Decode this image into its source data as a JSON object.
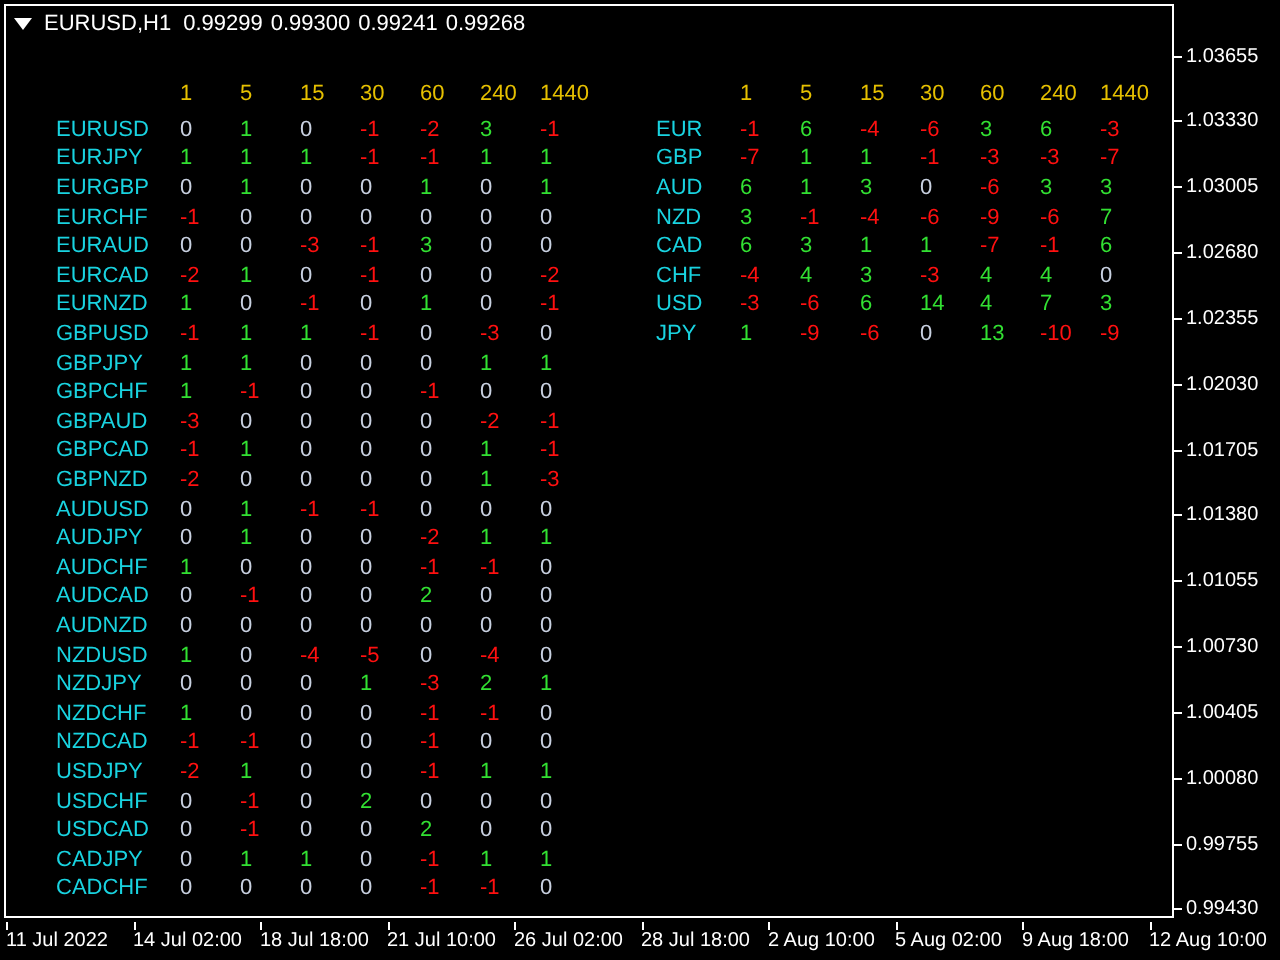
{
  "chart_header": {
    "symbol": "EURUSD,H1",
    "prices": [
      "0.99299",
      "0.99300",
      "0.99241",
      "0.99268"
    ]
  },
  "pair_table": {
    "columns": [
      "1",
      "5",
      "15",
      "30",
      "60",
      "240",
      "1440"
    ],
    "rows": [
      {
        "symbol": "EURUSD",
        "cells": [
          {
            "text": "0",
            "color": "#c8d0e0"
          },
          {
            "text": "1",
            "color": "#32e032"
          },
          {
            "text": "0",
            "color": "#c8d0e0"
          },
          {
            "text": "-1",
            "color": "#ff1010"
          },
          {
            "text": "-2",
            "color": "#ff1010"
          },
          {
            "text": "3",
            "color": "#32e032"
          },
          {
            "text": "-1",
            "color": "#ff1010"
          }
        ]
      },
      {
        "symbol": "EURJPY",
        "cells": [
          {
            "text": "1",
            "color": "#32e032"
          },
          {
            "text": "1",
            "color": "#32e032"
          },
          {
            "text": "1",
            "color": "#32e032"
          },
          {
            "text": "-1",
            "color": "#ff1010"
          },
          {
            "text": "-1",
            "color": "#ff1010"
          },
          {
            "text": "1",
            "color": "#32e032"
          },
          {
            "text": "1",
            "color": "#32e032"
          }
        ]
      },
      {
        "symbol": "EURGBP",
        "cells": [
          {
            "text": "0",
            "color": "#c8d0e0"
          },
          {
            "text": "1",
            "color": "#32e032"
          },
          {
            "text": "0",
            "color": "#c8d0e0"
          },
          {
            "text": "0",
            "color": "#c8d0e0"
          },
          {
            "text": "1",
            "color": "#32e032"
          },
          {
            "text": "0",
            "color": "#c8d0e0"
          },
          {
            "text": "1",
            "color": "#32e032"
          }
        ]
      },
      {
        "symbol": "EURCHF",
        "cells": [
          {
            "text": "-1",
            "color": "#ff1010"
          },
          {
            "text": "0",
            "color": "#c8d0e0"
          },
          {
            "text": "0",
            "color": "#c8d0e0"
          },
          {
            "text": "0",
            "color": "#c8d0e0"
          },
          {
            "text": "0",
            "color": "#c8d0e0"
          },
          {
            "text": "0",
            "color": "#c8d0e0"
          },
          {
            "text": "0",
            "color": "#c8d0e0"
          }
        ]
      },
      {
        "symbol": "EURAUD",
        "cells": [
          {
            "text": "0",
            "color": "#c8d0e0"
          },
          {
            "text": "0",
            "color": "#c8d0e0"
          },
          {
            "text": "-3",
            "color": "#ff1010"
          },
          {
            "text": "-1",
            "color": "#ff1010"
          },
          {
            "text": "3",
            "color": "#32e032"
          },
          {
            "text": "0",
            "color": "#c8d0e0"
          },
          {
            "text": "0",
            "color": "#c8d0e0"
          }
        ]
      },
      {
        "symbol": "EURCAD",
        "cells": [
          {
            "text": "-2",
            "color": "#ff1010"
          },
          {
            "text": "1",
            "color": "#32e032"
          },
          {
            "text": "0",
            "color": "#c8d0e0"
          },
          {
            "text": "-1",
            "color": "#ff1010"
          },
          {
            "text": "0",
            "color": "#c8d0e0"
          },
          {
            "text": "0",
            "color": "#c8d0e0"
          },
          {
            "text": "-2",
            "color": "#ff1010"
          }
        ]
      },
      {
        "symbol": "EURNZD",
        "cells": [
          {
            "text": "1",
            "color": "#32e032"
          },
          {
            "text": "0",
            "color": "#c8d0e0"
          },
          {
            "text": "-1",
            "color": "#ff1010"
          },
          {
            "text": "0",
            "color": "#c8d0e0"
          },
          {
            "text": "1",
            "color": "#32e032"
          },
          {
            "text": "0",
            "color": "#c8d0e0"
          },
          {
            "text": "-1",
            "color": "#ff1010"
          }
        ]
      },
      {
        "symbol": "GBPUSD",
        "cells": [
          {
            "text": "-1",
            "color": "#ff1010"
          },
          {
            "text": "1",
            "color": "#32e032"
          },
          {
            "text": "1",
            "color": "#32e032"
          },
          {
            "text": "-1",
            "color": "#ff1010"
          },
          {
            "text": "0",
            "color": "#c8d0e0"
          },
          {
            "text": "-3",
            "color": "#ff1010"
          },
          {
            "text": "0",
            "color": "#c8d0e0"
          }
        ]
      },
      {
        "symbol": "GBPJPY",
        "cells": [
          {
            "text": "1",
            "color": "#32e032"
          },
          {
            "text": "1",
            "color": "#32e032"
          },
          {
            "text": "0",
            "color": "#c8d0e0"
          },
          {
            "text": "0",
            "color": "#c8d0e0"
          },
          {
            "text": "0",
            "color": "#c8d0e0"
          },
          {
            "text": "1",
            "color": "#32e032"
          },
          {
            "text": "1",
            "color": "#32e032"
          }
        ]
      },
      {
        "symbol": "GBPCHF",
        "cells": [
          {
            "text": "1",
            "color": "#32e032"
          },
          {
            "text": "-1",
            "color": "#ff1010"
          },
          {
            "text": "0",
            "color": "#c8d0e0"
          },
          {
            "text": "0",
            "color": "#c8d0e0"
          },
          {
            "text": "-1",
            "color": "#ff1010"
          },
          {
            "text": "0",
            "color": "#c8d0e0"
          },
          {
            "text": "0",
            "color": "#c8d0e0"
          }
        ]
      },
      {
        "symbol": "GBPAUD",
        "cells": [
          {
            "text": "-3",
            "color": "#ff1010"
          },
          {
            "text": "0",
            "color": "#c8d0e0"
          },
          {
            "text": "0",
            "color": "#c8d0e0"
          },
          {
            "text": "0",
            "color": "#c8d0e0"
          },
          {
            "text": "0",
            "color": "#c8d0e0"
          },
          {
            "text": "-2",
            "color": "#ff1010"
          },
          {
            "text": "-1",
            "color": "#ff1010"
          }
        ]
      },
      {
        "symbol": "GBPCAD",
        "cells": [
          {
            "text": "-1",
            "color": "#ff1010"
          },
          {
            "text": "1",
            "color": "#32e032"
          },
          {
            "text": "0",
            "color": "#c8d0e0"
          },
          {
            "text": "0",
            "color": "#c8d0e0"
          },
          {
            "text": "0",
            "color": "#c8d0e0"
          },
          {
            "text": "1",
            "color": "#32e032"
          },
          {
            "text": "-1",
            "color": "#ff1010"
          }
        ]
      },
      {
        "symbol": "GBPNZD",
        "cells": [
          {
            "text": "-2",
            "color": "#ff1010"
          },
          {
            "text": "0",
            "color": "#c8d0e0"
          },
          {
            "text": "0",
            "color": "#c8d0e0"
          },
          {
            "text": "0",
            "color": "#c8d0e0"
          },
          {
            "text": "0",
            "color": "#c8d0e0"
          },
          {
            "text": "1",
            "color": "#32e032"
          },
          {
            "text": "-3",
            "color": "#ff1010"
          }
        ]
      },
      {
        "symbol": "AUDUSD",
        "cells": [
          {
            "text": "0",
            "color": "#c8d0e0"
          },
          {
            "text": "1",
            "color": "#32e032"
          },
          {
            "text": "-1",
            "color": "#ff1010"
          },
          {
            "text": "-1",
            "color": "#ff1010"
          },
          {
            "text": "0",
            "color": "#c8d0e0"
          },
          {
            "text": "0",
            "color": "#c8d0e0"
          },
          {
            "text": "0",
            "color": "#c8d0e0"
          }
        ]
      },
      {
        "symbol": "AUDJPY",
        "cells": [
          {
            "text": "0",
            "color": "#c8d0e0"
          },
          {
            "text": "1",
            "color": "#32e032"
          },
          {
            "text": "0",
            "color": "#c8d0e0"
          },
          {
            "text": "0",
            "color": "#c8d0e0"
          },
          {
            "text": "-2",
            "color": "#ff1010"
          },
          {
            "text": "1",
            "color": "#32e032"
          },
          {
            "text": "1",
            "color": "#32e032"
          }
        ]
      },
      {
        "symbol": "AUDCHF",
        "cells": [
          {
            "text": "1",
            "color": "#32e032"
          },
          {
            "text": "0",
            "color": "#c8d0e0"
          },
          {
            "text": "0",
            "color": "#c8d0e0"
          },
          {
            "text": "0",
            "color": "#c8d0e0"
          },
          {
            "text": "-1",
            "color": "#ff1010"
          },
          {
            "text": "-1",
            "color": "#ff1010"
          },
          {
            "text": "0",
            "color": "#c8d0e0"
          }
        ]
      },
      {
        "symbol": "AUDCAD",
        "cells": [
          {
            "text": "0",
            "color": "#c8d0e0"
          },
          {
            "text": "-1",
            "color": "#ff1010"
          },
          {
            "text": "0",
            "color": "#c8d0e0"
          },
          {
            "text": "0",
            "color": "#c8d0e0"
          },
          {
            "text": "2",
            "color": "#32e032"
          },
          {
            "text": "0",
            "color": "#c8d0e0"
          },
          {
            "text": "0",
            "color": "#c8d0e0"
          }
        ]
      },
      {
        "symbol": "AUDNZD",
        "cells": [
          {
            "text": "0",
            "color": "#c8d0e0"
          },
          {
            "text": "0",
            "color": "#c8d0e0"
          },
          {
            "text": "0",
            "color": "#c8d0e0"
          },
          {
            "text": "0",
            "color": "#c8d0e0"
          },
          {
            "text": "0",
            "color": "#c8d0e0"
          },
          {
            "text": "0",
            "color": "#c8d0e0"
          },
          {
            "text": "0",
            "color": "#c8d0e0"
          }
        ]
      },
      {
        "symbol": "NZDUSD",
        "cells": [
          {
            "text": "1",
            "color": "#32e032"
          },
          {
            "text": "0",
            "color": "#c8d0e0"
          },
          {
            "text": "-4",
            "color": "#ff1010"
          },
          {
            "text": "-5",
            "color": "#ff1010"
          },
          {
            "text": "0",
            "color": "#c8d0e0"
          },
          {
            "text": "-4",
            "color": "#ff1010"
          },
          {
            "text": "0",
            "color": "#c8d0e0"
          }
        ]
      },
      {
        "symbol": "NZDJPY",
        "cells": [
          {
            "text": "0",
            "color": "#c8d0e0"
          },
          {
            "text": "0",
            "color": "#c8d0e0"
          },
          {
            "text": "0",
            "color": "#c8d0e0"
          },
          {
            "text": "1",
            "color": "#32e032"
          },
          {
            "text": "-3",
            "color": "#ff1010"
          },
          {
            "text": "2",
            "color": "#32e032"
          },
          {
            "text": "1",
            "color": "#32e032"
          }
        ]
      },
      {
        "symbol": "NZDCHF",
        "cells": [
          {
            "text": "1",
            "color": "#32e032"
          },
          {
            "text": "0",
            "color": "#c8d0e0"
          },
          {
            "text": "0",
            "color": "#c8d0e0"
          },
          {
            "text": "0",
            "color": "#c8d0e0"
          },
          {
            "text": "-1",
            "color": "#ff1010"
          },
          {
            "text": "-1",
            "color": "#ff1010"
          },
          {
            "text": "0",
            "color": "#c8d0e0"
          }
        ]
      },
      {
        "symbol": "NZDCAD",
        "cells": [
          {
            "text": "-1",
            "color": "#ff1010"
          },
          {
            "text": "-1",
            "color": "#ff1010"
          },
          {
            "text": "0",
            "color": "#c8d0e0"
          },
          {
            "text": "0",
            "color": "#c8d0e0"
          },
          {
            "text": "-1",
            "color": "#ff1010"
          },
          {
            "text": "0",
            "color": "#c8d0e0"
          },
          {
            "text": "0",
            "color": "#c8d0e0"
          }
        ]
      },
      {
        "symbol": "USDJPY",
        "cells": [
          {
            "text": "-2",
            "color": "#ff1010"
          },
          {
            "text": "1",
            "color": "#32e032"
          },
          {
            "text": "0",
            "color": "#c8d0e0"
          },
          {
            "text": "0",
            "color": "#c8d0e0"
          },
          {
            "text": "-1",
            "color": "#ff1010"
          },
          {
            "text": "1",
            "color": "#32e032"
          },
          {
            "text": "1",
            "color": "#32e032"
          }
        ]
      },
      {
        "symbol": "USDCHF",
        "cells": [
          {
            "text": "0",
            "color": "#c8d0e0"
          },
          {
            "text": "-1",
            "color": "#ff1010"
          },
          {
            "text": "0",
            "color": "#c8d0e0"
          },
          {
            "text": "2",
            "color": "#32e032"
          },
          {
            "text": "0",
            "color": "#c8d0e0"
          },
          {
            "text": "0",
            "color": "#c8d0e0"
          },
          {
            "text": "0",
            "color": "#c8d0e0"
          }
        ]
      },
      {
        "symbol": "USDCAD",
        "cells": [
          {
            "text": "0",
            "color": "#c8d0e0"
          },
          {
            "text": "-1",
            "color": "#ff1010"
          },
          {
            "text": "0",
            "color": "#c8d0e0"
          },
          {
            "text": "0",
            "color": "#c8d0e0"
          },
          {
            "text": "2",
            "color": "#32e032"
          },
          {
            "text": "0",
            "color": "#c8d0e0"
          },
          {
            "text": "0",
            "color": "#c8d0e0"
          }
        ]
      },
      {
        "symbol": "CADJPY",
        "cells": [
          {
            "text": "0",
            "color": "#c8d0e0"
          },
          {
            "text": "1",
            "color": "#32e032"
          },
          {
            "text": "1",
            "color": "#32e032"
          },
          {
            "text": "0",
            "color": "#c8d0e0"
          },
          {
            "text": "-1",
            "color": "#ff1010"
          },
          {
            "text": "1",
            "color": "#32e032"
          },
          {
            "text": "1",
            "color": "#32e032"
          }
        ]
      },
      {
        "symbol": "CADCHF",
        "cells": [
          {
            "text": "0",
            "color": "#c8d0e0"
          },
          {
            "text": "0",
            "color": "#c8d0e0"
          },
          {
            "text": "0",
            "color": "#c8d0e0"
          },
          {
            "text": "0",
            "color": "#c8d0e0"
          },
          {
            "text": "-1",
            "color": "#ff1010"
          },
          {
            "text": "-1",
            "color": "#ff1010"
          },
          {
            "text": "0",
            "color": "#c8d0e0"
          }
        ]
      }
    ]
  },
  "currency_table": {
    "columns": [
      "1",
      "5",
      "15",
      "30",
      "60",
      "240",
      "1440"
    ],
    "rows": [
      {
        "symbol": "EUR",
        "cells": [
          {
            "text": "-1",
            "color": "#ff1010"
          },
          {
            "text": "6",
            "color": "#32e032"
          },
          {
            "text": "-4",
            "color": "#ff1010"
          },
          {
            "text": "-6",
            "color": "#ff1010"
          },
          {
            "text": "3",
            "color": "#32e032"
          },
          {
            "text": "6",
            "color": "#32e032"
          },
          {
            "text": "-3",
            "color": "#ff1010"
          }
        ]
      },
      {
        "symbol": "GBP",
        "cells": [
          {
            "text": "-7",
            "color": "#ff1010"
          },
          {
            "text": "1",
            "color": "#32e032"
          },
          {
            "text": "1",
            "color": "#32e032"
          },
          {
            "text": "-1",
            "color": "#ff1010"
          },
          {
            "text": "-3",
            "color": "#ff1010"
          },
          {
            "text": "-3",
            "color": "#ff1010"
          },
          {
            "text": "-7",
            "color": "#ff1010"
          }
        ]
      },
      {
        "symbol": "AUD",
        "cells": [
          {
            "text": "6",
            "color": "#32e032"
          },
          {
            "text": "1",
            "color": "#32e032"
          },
          {
            "text": "3",
            "color": "#32e032"
          },
          {
            "text": "0",
            "color": "#c8d0e0"
          },
          {
            "text": "-6",
            "color": "#ff1010"
          },
          {
            "text": "3",
            "color": "#32e032"
          },
          {
            "text": "3",
            "color": "#32e032"
          }
        ]
      },
      {
        "symbol": "NZD",
        "cells": [
          {
            "text": "3",
            "color": "#32e032"
          },
          {
            "text": "-1",
            "color": "#ff1010"
          },
          {
            "text": "-4",
            "color": "#ff1010"
          },
          {
            "text": "-6",
            "color": "#ff1010"
          },
          {
            "text": "-9",
            "color": "#ff1010"
          },
          {
            "text": "-6",
            "color": "#ff1010"
          },
          {
            "text": "7",
            "color": "#32e032"
          }
        ]
      },
      {
        "symbol": "CAD",
        "cells": [
          {
            "text": "6",
            "color": "#32e032"
          },
          {
            "text": "3",
            "color": "#32e032"
          },
          {
            "text": "1",
            "color": "#32e032"
          },
          {
            "text": "1",
            "color": "#32e032"
          },
          {
            "text": "-7",
            "color": "#ff1010"
          },
          {
            "text": "-1",
            "color": "#ff1010"
          },
          {
            "text": "6",
            "color": "#32e032"
          }
        ]
      },
      {
        "symbol": "CHF",
        "cells": [
          {
            "text": "-4",
            "color": "#ff1010"
          },
          {
            "text": "4",
            "color": "#32e032"
          },
          {
            "text": "3",
            "color": "#32e032"
          },
          {
            "text": "-3",
            "color": "#ff1010"
          },
          {
            "text": "4",
            "color": "#32e032"
          },
          {
            "text": "4",
            "color": "#32e032"
          },
          {
            "text": "0",
            "color": "#c8d0e0"
          }
        ]
      },
      {
        "symbol": "USD",
        "cells": [
          {
            "text": "-3",
            "color": "#ff1010"
          },
          {
            "text": "-6",
            "color": "#ff1010"
          },
          {
            "text": "6",
            "color": "#32e032"
          },
          {
            "text": "14",
            "color": "#32e032"
          },
          {
            "text": "4",
            "color": "#32e032"
          },
          {
            "text": "7",
            "color": "#32e032"
          },
          {
            "text": "3",
            "color": "#32e032"
          }
        ]
      },
      {
        "symbol": "JPY",
        "cells": [
          {
            "text": "1",
            "color": "#32e032"
          },
          {
            "text": "-9",
            "color": "#ff1010"
          },
          {
            "text": "-6",
            "color": "#ff1010"
          },
          {
            "text": "0",
            "color": "#c8d0e0"
          },
          {
            "text": "13",
            "color": "#32e032"
          },
          {
            "text": "-10",
            "color": "#ff1010"
          },
          {
            "text": "-9",
            "color": "#ff1010"
          }
        ]
      }
    ]
  },
  "price_axis": [
    "1.03655",
    "1.03330",
    "1.03005",
    "1.02680",
    "1.02355",
    "1.02030",
    "1.01705",
    "1.01380",
    "1.01055",
    "1.00730",
    "1.00405",
    "1.00080",
    "0.99755",
    "0.99430"
  ],
  "time_axis": [
    "11 Jul 2022",
    "14 Jul 02:00",
    "18 Jul 18:00",
    "21 Jul 10:00",
    "26 Jul 02:00",
    "28 Jul 18:00",
    "2 Aug 10:00",
    "5 Aug 02:00",
    "9 Aug 18:00",
    "12 Aug 10:00"
  ]
}
